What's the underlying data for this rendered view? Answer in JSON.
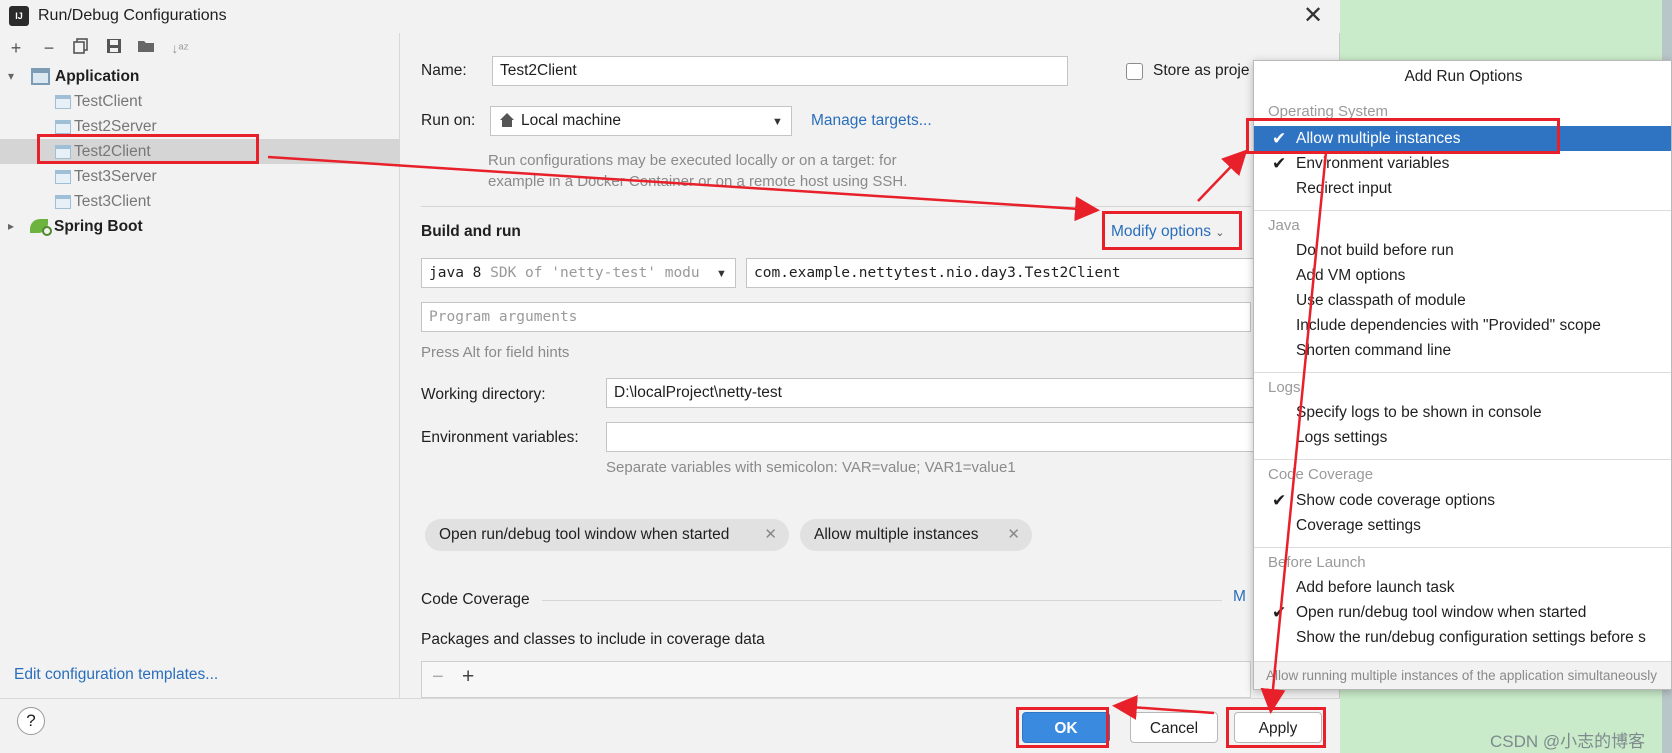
{
  "window": {
    "title": "Run/Debug Configurations",
    "app_icon_text": "IJ"
  },
  "sidebar": {
    "toolbar": [
      "add-icon",
      "remove-icon",
      "copy-icon",
      "save-icon",
      "folder-icon",
      "sort-icon"
    ],
    "groups": [
      {
        "label": "Application",
        "expanded": true,
        "items": [
          "TestClient",
          "Test2Server",
          "Test2Client",
          "Test3Server",
          "Test3Client"
        ],
        "selected": "Test2Client"
      },
      {
        "label": "Spring Boot",
        "expanded": false
      }
    ],
    "edit_templates_link": "Edit configuration templates..."
  },
  "form": {
    "name_label": "Name:",
    "name_value": "Test2Client",
    "store_as_project_label": "Store as proje",
    "run_on_label": "Run on:",
    "run_on_value": "Local machine",
    "manage_targets_link": "Manage targets...",
    "run_on_hint_1": "Run configurations may be executed locally or on a target: for",
    "run_on_hint_2": "example in a Docker Container or on a remote host using SSH.",
    "build_and_run_label": "Build and run",
    "modify_options_link": "Modify options",
    "jdk_value_a": "java 8",
    "jdk_value_b": "SDK of 'netty-test' modu",
    "main_class_value": "com.example.nettytest.nio.day3.Test2Client",
    "program_args_placeholder": "Program arguments",
    "field_hints_text": "Press Alt for field hints",
    "working_dir_label": "Working directory:",
    "working_dir_value": "D:\\localProject\\netty-test",
    "env_vars_label": "Environment variables:",
    "env_vars_value": "",
    "env_vars_hint": "Separate variables with semicolon: VAR=value; VAR1=value1",
    "chips": [
      "Open run/debug tool window when started",
      "Allow multiple instances"
    ],
    "code_coverage_label": "Code Coverage",
    "code_coverage_more": "M",
    "packages_label": "Packages and classes to include in coverage data"
  },
  "buttons": {
    "help": "?",
    "ok": "OK",
    "cancel": "Cancel",
    "apply": "Apply"
  },
  "popup": {
    "title": "Add Run Options",
    "sections": [
      {
        "name": "Operating System",
        "items": [
          {
            "label": "Allow multiple instances",
            "checked": true,
            "selected": true
          },
          {
            "label": "Environment variables",
            "checked": true
          },
          {
            "label": "Redirect input",
            "checked": false
          }
        ]
      },
      {
        "name": "Java",
        "items": [
          {
            "label": "Do not build before run",
            "checked": false
          },
          {
            "label": "Add VM options",
            "checked": false
          },
          {
            "label": "Use classpath of module",
            "checked": false
          },
          {
            "label": "Include dependencies with \"Provided\" scope",
            "checked": false
          },
          {
            "label": "Shorten command line",
            "checked": false
          }
        ]
      },
      {
        "name": "Logs",
        "items": [
          {
            "label": "Specify logs to be shown in console",
            "checked": false
          },
          {
            "label": "Logs settings",
            "checked": false
          }
        ]
      },
      {
        "name": "Code Coverage",
        "items": [
          {
            "label": "Show code coverage options",
            "checked": true
          },
          {
            "label": "Coverage settings",
            "checked": false
          }
        ]
      },
      {
        "name": "Before Launch",
        "items": [
          {
            "label": "Add before launch task",
            "checked": false
          },
          {
            "label": "Open run/debug tool window when started",
            "checked": true
          },
          {
            "label": "Show the run/debug configuration settings before s",
            "checked": false
          }
        ]
      }
    ],
    "footer": "Allow running multiple instances of the application simultaneously"
  },
  "colors": {
    "accent": "#2f74c3",
    "link": "#2a6ebb",
    "annotation": "#e8202a",
    "ok_button": "#3a8be0"
  },
  "watermark": "CSDN @小志的博客"
}
